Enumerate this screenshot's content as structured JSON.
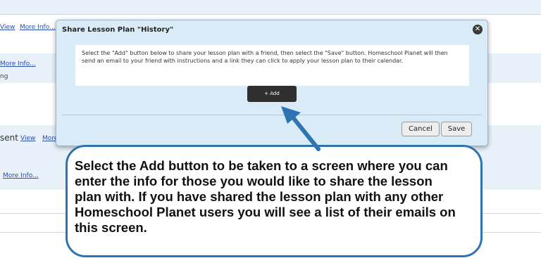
{
  "background": {
    "row1": {
      "view_label": "View",
      "more_info_label": "More Info..."
    },
    "row2": {
      "more_info_label": "More Info...",
      "text_fragment": "ng"
    },
    "row3": {
      "text_fragment": "sent",
      "view_label": "View",
      "more_label": "More"
    },
    "row4": {
      "more_info_label": "More Info..."
    }
  },
  "dialog": {
    "title": "Share Lesson Plan \"History\"",
    "instructions": "Select the \"Add\" button below to share your lesson plan with a friend, then select the \"Save\" button. Homeschool Planet will then send an email to your friend with instructions and a link they can click to apply your lesson plan to their calendar.",
    "add_label": "+ Add",
    "cancel_label": "Cancel",
    "save_label": "Save",
    "close_icon": "close-icon"
  },
  "callout": {
    "text": "Select the Add button to be taken to a screen where you can enter the info for those you would like to share the lesson plan with. If you have shared the lesson plan with any other Homeschool Planet users you will see a list of their emails on this screen."
  },
  "colors": {
    "dialog_bg": "#d9ebf7",
    "arrow": "#2f74b0",
    "callout_border": "#2f74b0",
    "add_button_bg": "#2f2f2f"
  }
}
